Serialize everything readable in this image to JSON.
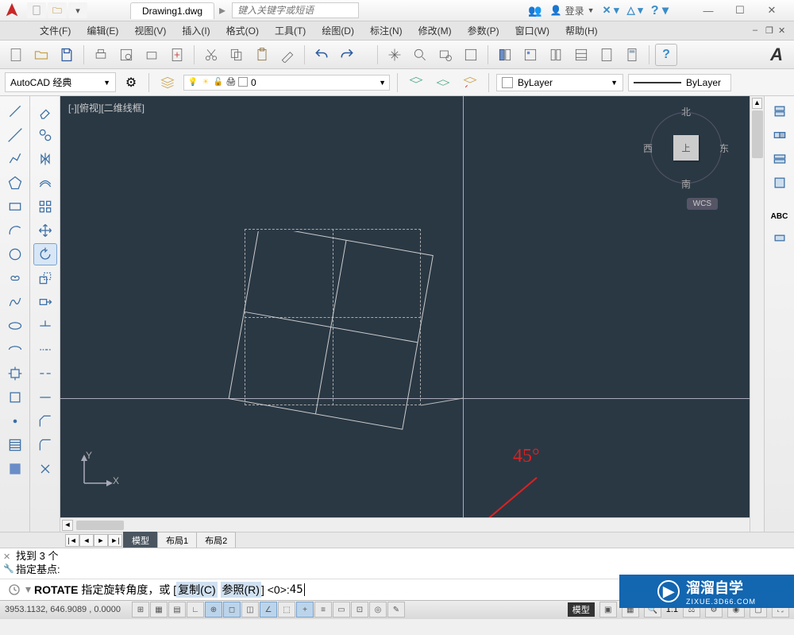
{
  "title": {
    "filename": "Drawing1.dwg",
    "search_placeholder": "键入关键字或短语",
    "login": "登录"
  },
  "menu": {
    "file": "文件(F)",
    "edit": "编辑(E)",
    "view": "视图(V)",
    "insert": "插入(I)",
    "format": "格式(O)",
    "tools": "工具(T)",
    "draw": "绘图(D)",
    "dim": "标注(N)",
    "modify": "修改(M)",
    "param": "参数(P)",
    "window": "窗口(W)",
    "help": "帮助(H)"
  },
  "workspace": {
    "name": "AutoCAD 经典"
  },
  "layer": {
    "current": "0",
    "bylayer1": "ByLayer",
    "bylayer2": "ByLayer"
  },
  "canvas": {
    "label": "[-][俯视][二维线框]",
    "north": "北",
    "south": "南",
    "east": "东",
    "west": "西",
    "top": "上",
    "wcs": "WCS",
    "ucs_y": "Y",
    "ucs_x": "X"
  },
  "annotation": {
    "angle": "45°"
  },
  "layout": {
    "model": "模型",
    "layout1": "布局1",
    "layout2": "布局2"
  },
  "cmd": {
    "hist1": "找到 3 个",
    "hist2": "指定基点:",
    "name": "ROTATE",
    "prompt": "指定旋转角度，或 [",
    "copy": "复制(C)",
    "ref": "参照(R)",
    "rest": "] <0>: ",
    "input": "45"
  },
  "status": {
    "coords": "3953.1132, 646.9089 , 0.0000",
    "model": "模型",
    "scale": "1:1"
  },
  "watermark": {
    "brand": "溜溜自学",
    "url": "ZIXUE.3D66.COM"
  }
}
